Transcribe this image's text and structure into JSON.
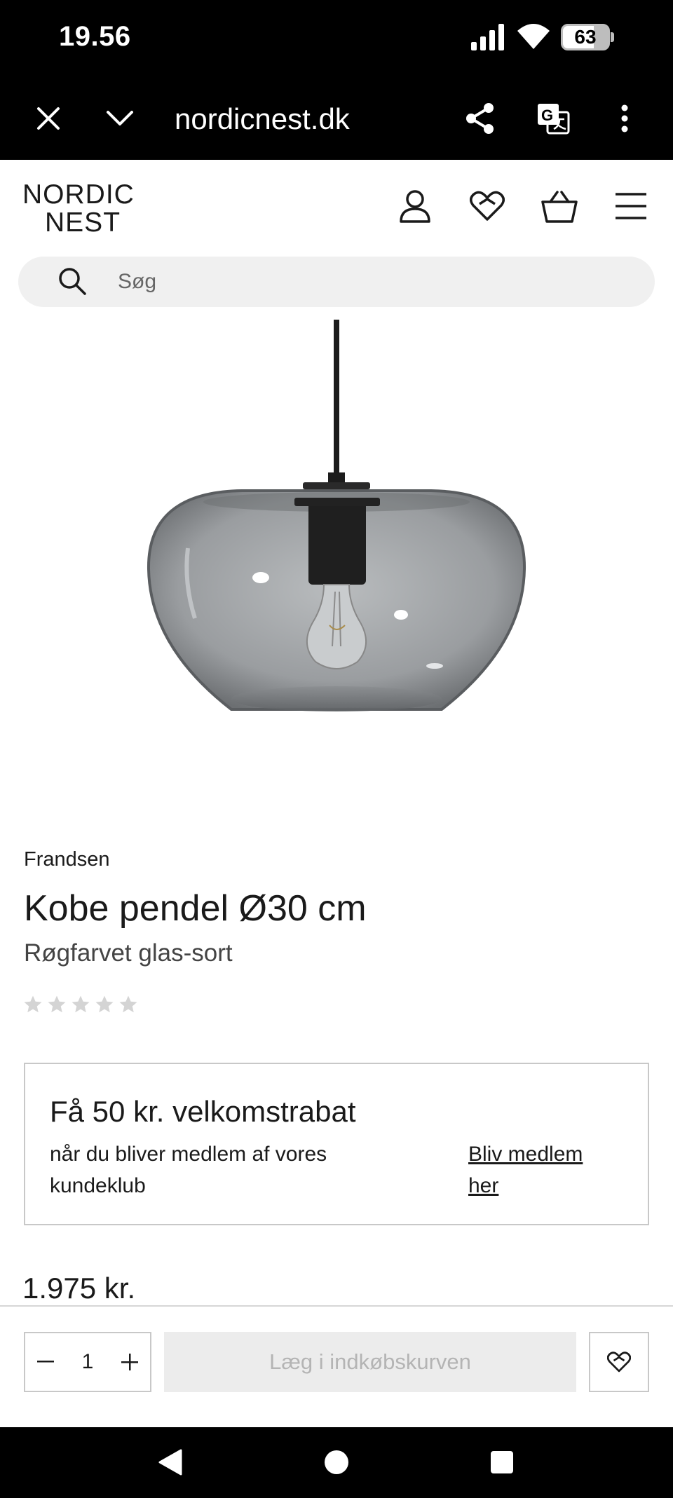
{
  "status_bar": {
    "time": "19.56",
    "battery": "63"
  },
  "browser": {
    "url": "nordicnest.dk"
  },
  "site": {
    "logo_line1": "NORDIC",
    "logo_line2": "NEST",
    "search_placeholder": "Søg"
  },
  "product": {
    "brand": "Frandsen",
    "title": "Kobe pendel Ø30 cm",
    "variant": "Røgfarvet glas-sort",
    "rating": 0,
    "rating_max": 5,
    "price": "1.975 kr."
  },
  "club": {
    "heading": "Få 50 kr. velkomstrabat",
    "description": "når du bliver medlem af vores kundeklub",
    "link": "Bliv medlem her"
  },
  "buy_bar": {
    "quantity": "1",
    "add_to_cart": "Læg i indkøbskurven"
  },
  "icons": {
    "close": "close-icon",
    "collapse": "chevron-down-icon",
    "share": "share-icon",
    "translate": "translate-icon",
    "more": "more-vert-icon",
    "account": "user-icon",
    "wishlist": "heart-icon",
    "cart": "basket-icon",
    "menu": "hamburger-menu-icon",
    "search": "search-icon"
  },
  "colors": {
    "accent": "#1a1a1a",
    "disabled_button": "#ececec"
  }
}
